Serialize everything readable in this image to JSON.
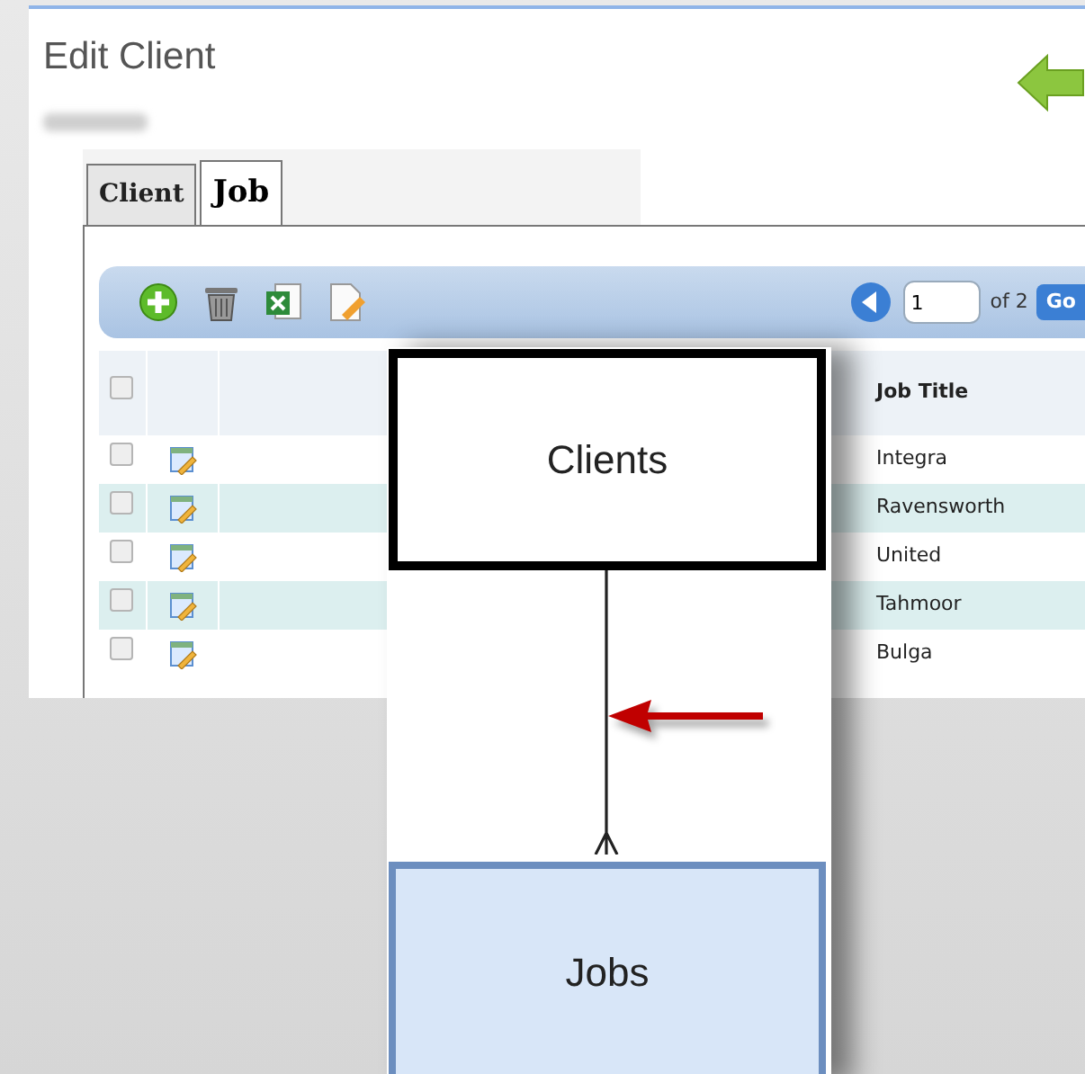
{
  "page": {
    "title": "Edit Client"
  },
  "tabs": [
    {
      "label": "Client",
      "selected": false
    },
    {
      "label": "Job",
      "selected": true
    }
  ],
  "pager": {
    "page": "1",
    "total": "of 2",
    "go": "Go"
  },
  "table": {
    "columns": [
      "Job Title"
    ],
    "header_checked": false,
    "rows": [
      {
        "job_title": "Integra",
        "checked": false
      },
      {
        "job_title": "Ravensworth",
        "checked": false
      },
      {
        "job_title": "United",
        "checked": false
      },
      {
        "job_title": "Tahmoor",
        "checked": false
      },
      {
        "job_title": "Bulga",
        "checked": false
      }
    ]
  },
  "diagram": {
    "entities": [
      {
        "name": "Clients",
        "kind": "parent"
      },
      {
        "name": "Jobs",
        "kind": "child"
      }
    ]
  }
}
